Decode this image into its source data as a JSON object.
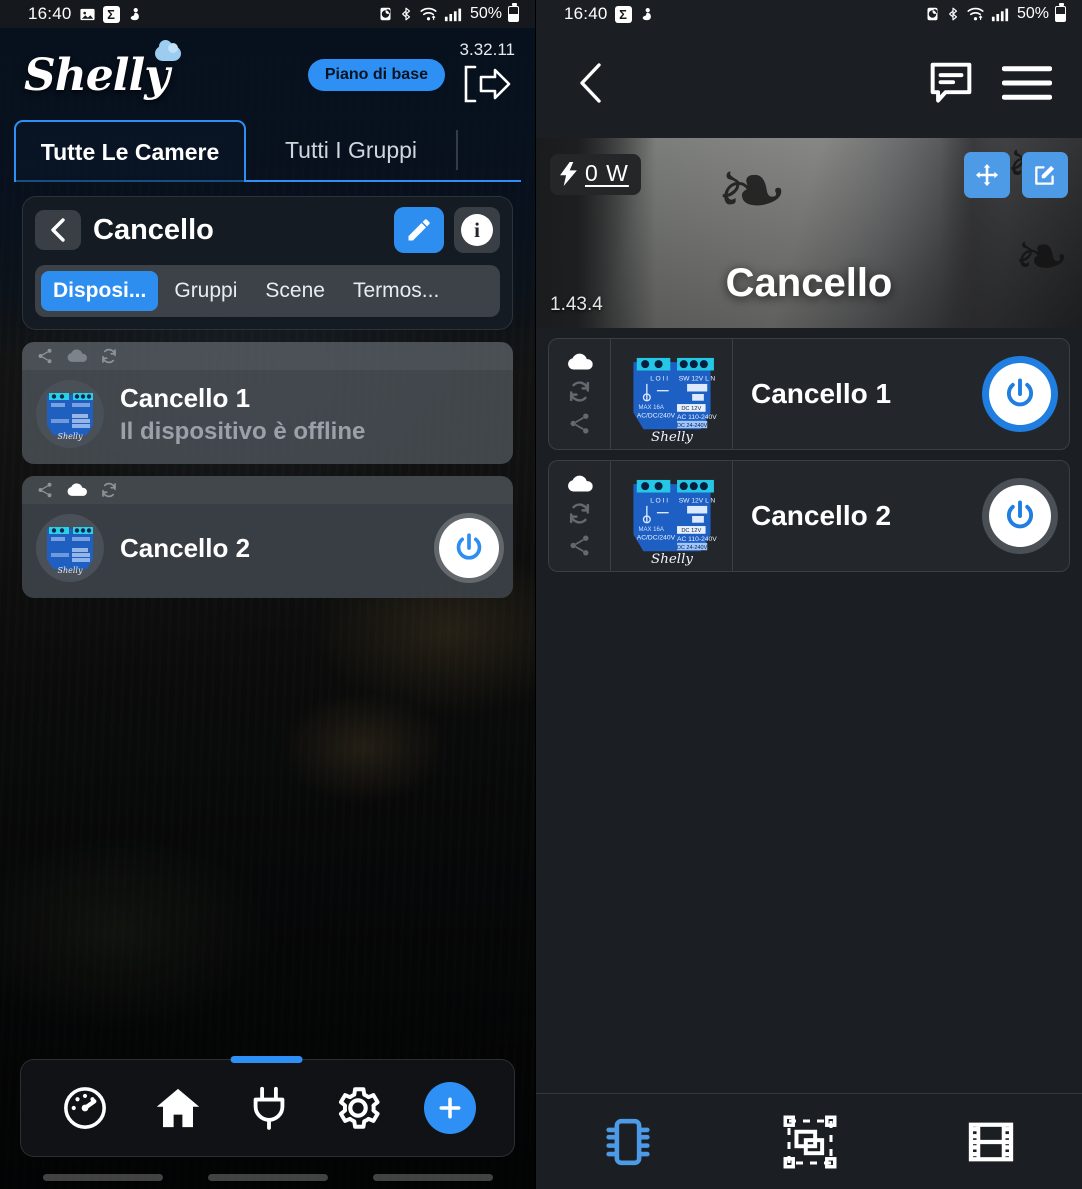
{
  "left": {
    "statusbar": {
      "time": "16:40",
      "icons": [
        "image-icon",
        "sigma-icon",
        "figure-icon"
      ],
      "right_icons": [
        "data-saver-icon",
        "bluetooth-icon",
        "wifi-icon",
        "signal-icon"
      ],
      "battery_pct": "50%"
    },
    "brand": "Shelly",
    "plan_label": "Piano di base",
    "app_version": "3.32.11",
    "logout_icon": "logout-icon",
    "tabs": [
      {
        "label": "Tutte Le Camere",
        "active": true
      },
      {
        "label": "Tutti I Gruppi",
        "active": false
      }
    ],
    "room": {
      "title": "Cancello",
      "back_icon": "chevron-left-icon",
      "edit_icon": "pencil-icon",
      "info_icon": "info-icon",
      "segments": [
        {
          "label": "Disposi...",
          "active": true
        },
        {
          "label": "Gruppi",
          "active": false
        },
        {
          "label": "Scene",
          "active": false
        },
        {
          "label": "Termos...",
          "active": false
        }
      ]
    },
    "devices": [
      {
        "name": "Cancello 1",
        "status": "Il dispositivo è offline",
        "offline": true,
        "has_power": false,
        "badges": [
          "share-icon",
          "cloud-icon",
          "sync-icon"
        ]
      },
      {
        "name": "Cancello 2",
        "status": "",
        "offline": false,
        "has_power": true,
        "badges": [
          "share-icon",
          "cloud-icon",
          "sync-icon"
        ]
      }
    ],
    "bottom_nav": [
      {
        "icon": "dashboard-gauge-icon",
        "active": false
      },
      {
        "icon": "home-icon",
        "active": true
      },
      {
        "icon": "plug-icon",
        "active": false
      },
      {
        "icon": "gear-icon",
        "active": false
      },
      {
        "icon": "plus-icon",
        "active": false
      }
    ]
  },
  "right": {
    "statusbar": {
      "time": "16:40",
      "icons": [
        "sigma-icon",
        "figure-icon"
      ],
      "battery_pct": "50%"
    },
    "header": {
      "back_icon": "chevron-left-icon",
      "comment_icon": "comment-icon",
      "menu_icon": "hamburger-menu-icon"
    },
    "hero": {
      "power_value": "0 W",
      "power_icon": "bolt-icon",
      "title": "Cancello",
      "version": "1.43.4",
      "move_icon": "move-arrows-icon",
      "edit_icon": "edit-square-icon"
    },
    "devices": [
      {
        "name": "Cancello 1",
        "state": "on",
        "badges": [
          "cloud-icon",
          "sync-icon",
          "share-icon"
        ]
      },
      {
        "name": "Cancello 2",
        "state": "off",
        "badges": [
          "cloud-icon",
          "sync-icon",
          "share-icon"
        ]
      }
    ],
    "bottom_nav": [
      {
        "icon": "chip-icon",
        "active": true
      },
      {
        "icon": "group-shapes-icon",
        "active": false
      },
      {
        "icon": "film-strip-icon",
        "active": false
      }
    ]
  },
  "colors": {
    "accent_blue": "#2e90f5",
    "hero_blue": "#4d9ae6",
    "dark_bg": "#1b1f24",
    "card_bg": "#23272c"
  }
}
